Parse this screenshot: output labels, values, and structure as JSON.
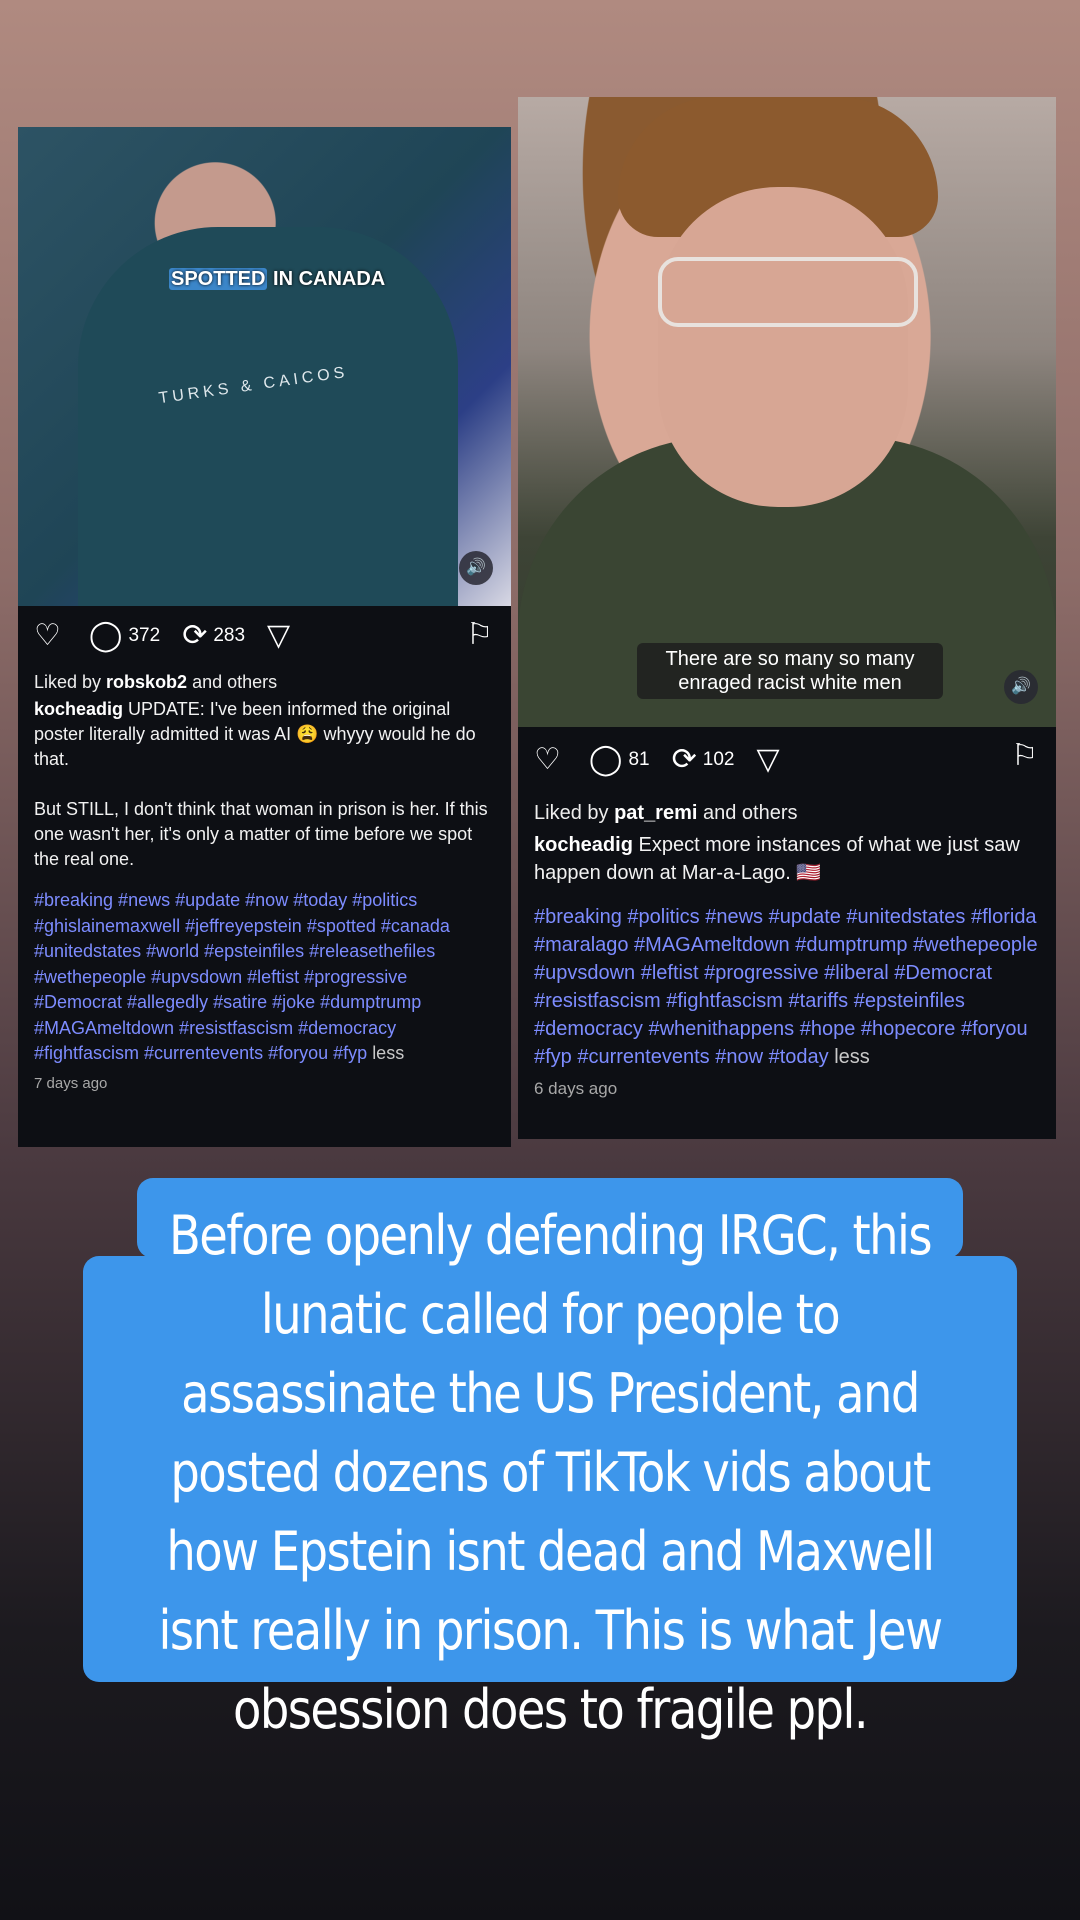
{
  "post1": {
    "video_overlay_highlight": "SPOTTED",
    "video_overlay_rest": " IN CANADA",
    "shirt_text": "TURKS & CAICOS",
    "comments": "372",
    "reposts": "283",
    "liked_prefix": "Liked by ",
    "liked_user": "robskob2",
    "liked_suffix": " and others",
    "author": "kocheadig",
    "caption": " UPDATE: I've been informed the original poster literally admitted it was AI 😩 whyyy would he do that.\n\nBut STILL, I don't think that woman in prison is her. If this one wasn't her, it's only a matter of time before we spot the real one.",
    "tags": "#breaking #news #update #now #today #politics #ghislainemaxwell #jeffreyepstein #spotted #canada #unitedstates #world #epsteinfiles #releasethefiles #wethepeople #upvsdown #leftist #progressive #Democrat #allegedly #satire #joke #dumptrump #MAGAmeltdown #resistfascism #democracy #fightfascism #currentevents #foryou #fyp",
    "less": "less",
    "age": "7 days ago"
  },
  "post2": {
    "video_overlay": "There are so many so many enraged racist white men",
    "comments": "81",
    "reposts": "102",
    "liked_prefix": "Liked by ",
    "liked_user": "pat_remi",
    "liked_suffix": " and others",
    "author": "kocheadig",
    "caption": " Expect more instances of what we just saw happen down at Mar-a-Lago. 🇺🇸",
    "tags": "#breaking #politics #news #update #unitedstates #florida #maralago #MAGAmeltdown #dumptrump #wethepeople #upvsdown #leftist #progressive #liberal #Democrat #resistfascism #fightfascism #tariffs #epsteinfiles #democracy #whenithappens #hope #hopecore #foryou #fyp #currentevents #now #today",
    "less": "less",
    "age": "6 days ago"
  },
  "icons": {
    "like": "♡",
    "comment": "◯",
    "repost": "⟳",
    "share": "▽",
    "bookmark": "⚐",
    "sound": "🔊"
  },
  "banner": {
    "text": "Before openly defending IRGC, this lunatic called for people to assassinate the US President, and posted dozens of TikTok vids about how Epstein isnt dead and Maxwell isnt really in prison. This is what Jew obsession does to fragile ppl.",
    "color": "#3d96eb"
  }
}
